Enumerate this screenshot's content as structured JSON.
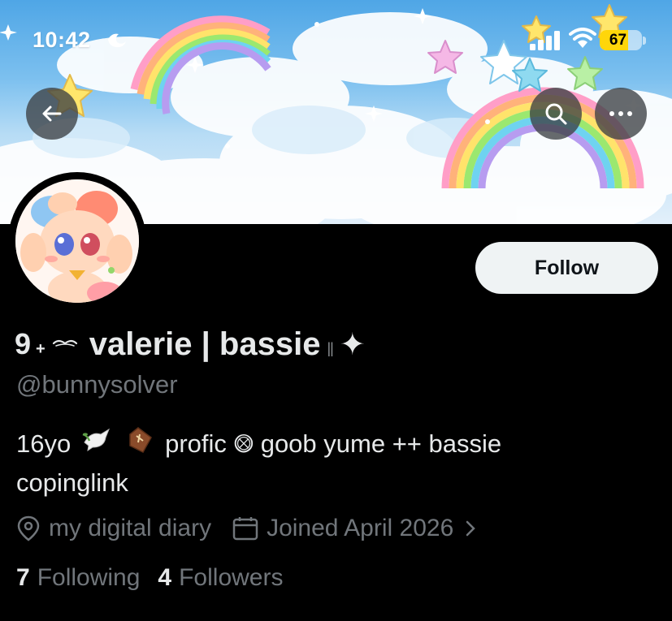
{
  "status_bar": {
    "time": "10:42",
    "battery": "67",
    "battery_level": 0.67
  },
  "header": {
    "back_icon": "arrow-left-icon",
    "search_icon": "search-icon",
    "more_icon": "ellipsis-icon"
  },
  "profile": {
    "name_prefix": "𝄢",
    "name_plus": "+",
    "name_mustache": "૰",
    "name": "valerie | bassie",
    "name_bars": "||",
    "name_sparkle": "✦",
    "handle": "@bunnysolver",
    "bio_start": "16yo",
    "bio_mid": "profic",
    "bio_symbol": "⨷",
    "bio_end": "goob yume ++ bassie",
    "bio_line2": "copinglink",
    "location": "my digital diary",
    "joined": "Joined April 2026",
    "follow_label": "Follow"
  },
  "stats": {
    "following_count": "7",
    "following_label": "Following",
    "followers_count": "4",
    "followers_label": "Followers"
  },
  "colors": {
    "background": "#000000",
    "muted_text": "#71767b",
    "primary_text": "#e7e9ea",
    "follow_bg": "#eff3f4",
    "battery": "#ffd60a"
  }
}
